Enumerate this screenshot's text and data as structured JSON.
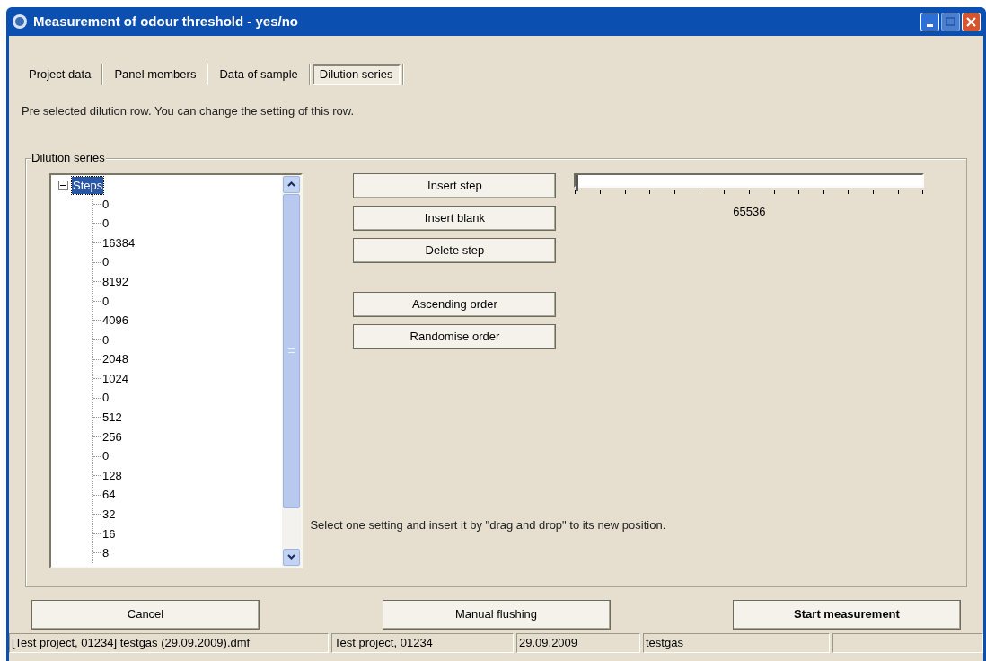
{
  "window": {
    "title": "Measurement of odour threshold - yes/no"
  },
  "tabs": [
    {
      "label": "Project data",
      "selected": false
    },
    {
      "label": "Panel members",
      "selected": false
    },
    {
      "label": "Data of sample",
      "selected": false
    },
    {
      "label": "Dilution series",
      "selected": true
    }
  ],
  "intro": "Pre selected dilution row. You can change the setting of this row.",
  "group": {
    "title": "Dilution series",
    "tree": {
      "label": "Steps",
      "expanded": true,
      "selected": true,
      "children": [
        {
          "label": "0"
        },
        {
          "label": "0"
        },
        {
          "label": "16384"
        },
        {
          "label": "0"
        },
        {
          "label": "8192"
        },
        {
          "label": "0"
        },
        {
          "label": "4096"
        },
        {
          "label": "0"
        },
        {
          "label": "2048"
        },
        {
          "label": "1024"
        },
        {
          "label": "0"
        },
        {
          "label": "512"
        },
        {
          "label": "256"
        },
        {
          "label": "0"
        },
        {
          "label": "128"
        },
        {
          "label": "64"
        },
        {
          "label": "32"
        },
        {
          "label": "16"
        },
        {
          "label": "8"
        }
      ]
    },
    "step_buttons": [
      "Insert step",
      "Insert blank",
      "Delete step"
    ],
    "order_buttons": [
      "Ascending order",
      "Randomise order"
    ],
    "slider": {
      "level": 0,
      "reading": "65536"
    },
    "hint": "Select one setting and insert it by \"drag and drop\" to its new position."
  },
  "buttons": [
    {
      "label": "Cancel",
      "bold": false
    },
    {
      "label": "Manual flushing",
      "bold": false
    },
    {
      "label": "Start measurement",
      "bold": true
    }
  ],
  "status_bar": [
    "[Test project, 01234] testgas (29.09.2009).dmf",
    "Test project, 01234",
    "29.09.2009",
    "testgas"
  ]
}
